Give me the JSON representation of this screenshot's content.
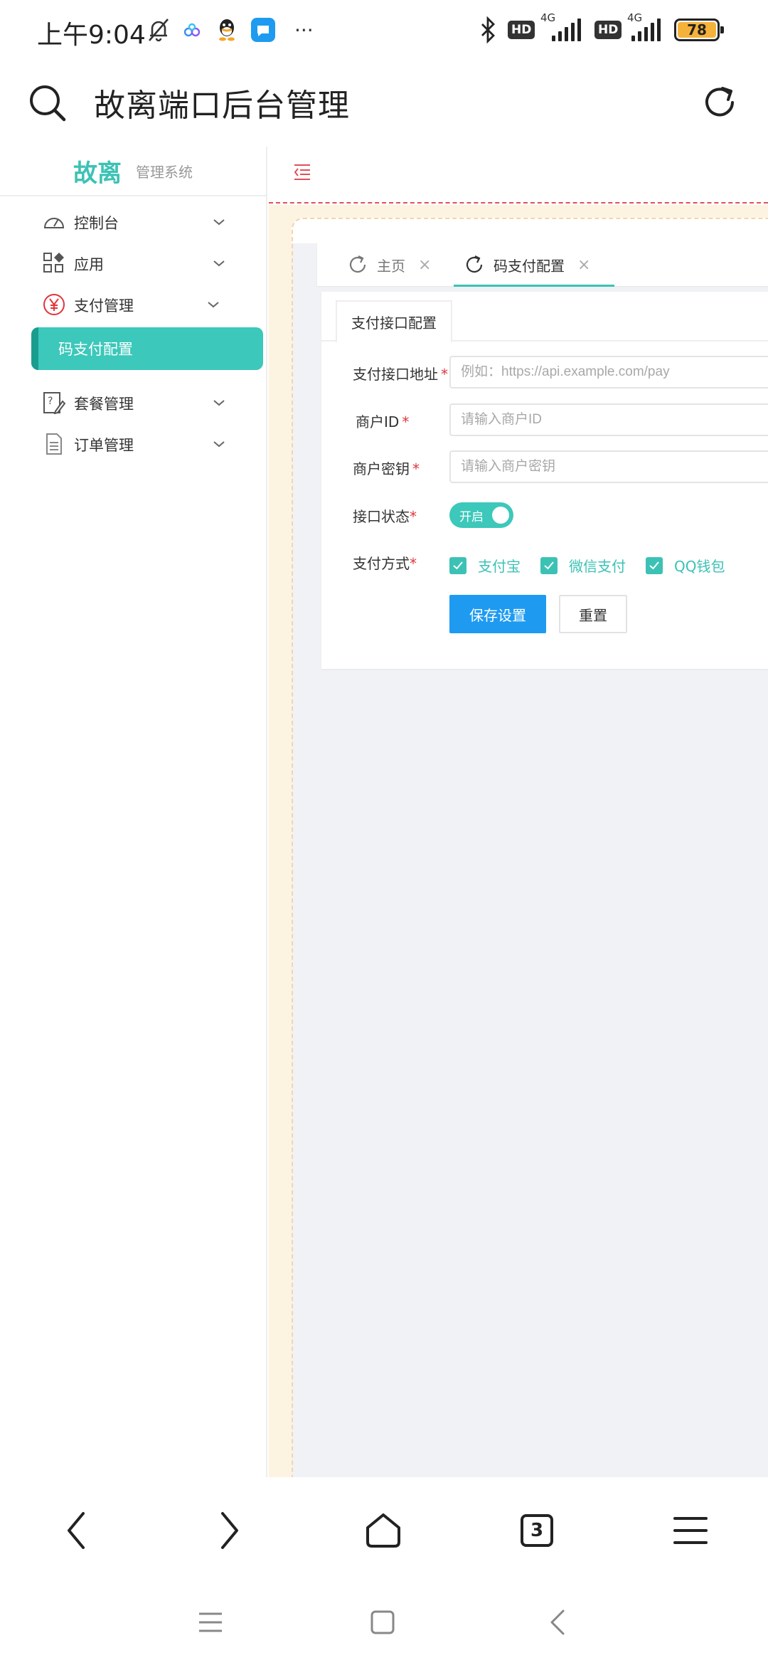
{
  "status_bar": {
    "time": "上午9:04",
    "more": "···",
    "hd1": "HD",
    "net1": "4G",
    "hd2": "HD",
    "net2": "4G",
    "battery": "78"
  },
  "browser": {
    "title": "故离端口后台管理"
  },
  "sidebar": {
    "brand_name": "故离",
    "brand_sub": "管理系统",
    "items": [
      {
        "label": "控制台"
      },
      {
        "label": "应用"
      },
      {
        "label": "支付管理"
      },
      {
        "label": "码支付配置"
      },
      {
        "label": "套餐管理"
      },
      {
        "label": "订单管理"
      }
    ]
  },
  "tabs": [
    {
      "label": "主页"
    },
    {
      "label": "码支付配置"
    }
  ],
  "card": {
    "tab": "支付接口配置",
    "fields": {
      "url_label": "支付接口地址",
      "url_placeholder": "例如：https://api.example.com/pay",
      "merchant_label": "商户ID",
      "merchant_placeholder": "请输入商户ID",
      "key_label": "商户密钥",
      "key_placeholder": "请输入商户密钥",
      "status_label": "接口状态",
      "status_value": "开启",
      "methods_label": "支付方式",
      "required_mark": "*"
    },
    "methods": [
      "支付宝",
      "微信支付",
      "QQ钱包"
    ],
    "buttons": {
      "save": "保存设置",
      "reset": "重置"
    }
  },
  "bottom_nav": {
    "tab_count": "3"
  },
  "colors": {
    "accent": "#3cc2b5",
    "primary_button": "#1e9bf0",
    "required": "#e0353b"
  }
}
